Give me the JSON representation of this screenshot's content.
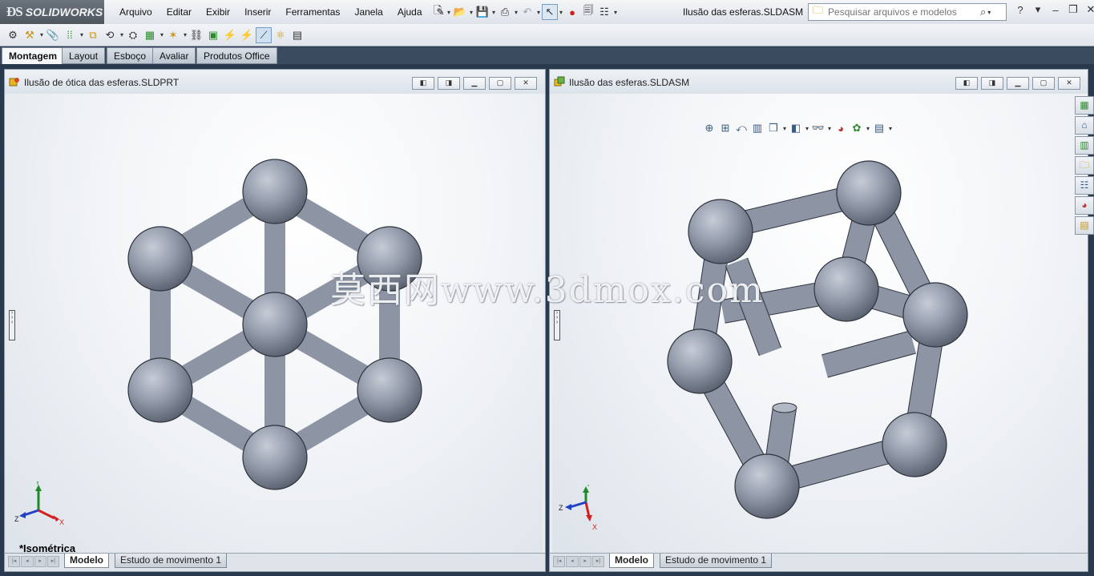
{
  "app": {
    "logo_mark": "ƉS",
    "logo_text": "SOLIDWORKS",
    "window_title": "Ilusão das esferas.SLDASM"
  },
  "menu": {
    "items": [
      "Arquivo",
      "Editar",
      "Exibir",
      "Inserir",
      "Ferramentas",
      "Janela",
      "Ajuda"
    ]
  },
  "search": {
    "placeholder": "Pesquisar arquivos e modelos"
  },
  "command_tabs": [
    {
      "label": "Montagem",
      "active": true
    },
    {
      "label": "Layout",
      "active": false
    },
    {
      "label": "Esboço",
      "active": false
    },
    {
      "label": "Avaliar",
      "active": false
    },
    {
      "label": "Produtos Office",
      "active": false
    }
  ],
  "left_document": {
    "title": "Ilusão de ótica das esferas.SLDPRT",
    "view_orientation": "*Isométrica",
    "triad": {
      "y": "Y",
      "x": "X",
      "z": "Z"
    },
    "bottom_tabs": [
      {
        "label": "Modelo",
        "active": true
      },
      {
        "label": "Estudo de movimento 1",
        "active": false
      }
    ]
  },
  "right_document": {
    "title": "Ilusão das esferas.SLDASM",
    "triad": {
      "y": "Y",
      "x": "X",
      "z": "Z"
    },
    "bottom_tabs": [
      {
        "label": "Modelo",
        "active": true
      },
      {
        "label": "Estudo de movimento 1",
        "active": false
      }
    ]
  },
  "watermark": "莫西网www.3dmox.com",
  "colors": {
    "sphere": "#8f97a7",
    "rod": "#8d95a5",
    "edge": "#2e333c",
    "triad_x": "#d42020",
    "triad_y": "#1e8a2a",
    "triad_z": "#2040c8"
  },
  "icons": {
    "new_document": "new-document-icon",
    "open": "open-folder-icon",
    "save": "save-icon",
    "print": "print-icon",
    "undo": "undo-icon",
    "select": "select-arrow-icon",
    "rebuild": "rebuild-traffic-light-icon",
    "options": "options-icon",
    "help": "help-icon"
  }
}
